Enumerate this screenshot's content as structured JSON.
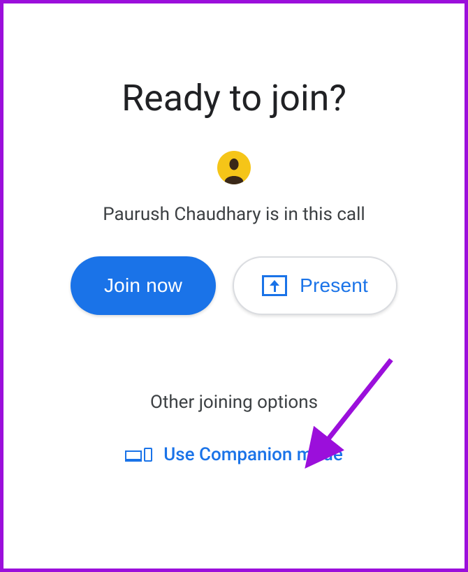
{
  "title": "Ready to join?",
  "participant_name": "Paurush Chaudhary",
  "call_status_suffix": " is in this call",
  "buttons": {
    "join_label": "Join now",
    "present_label": "Present"
  },
  "other_options": {
    "heading": "Other joining options",
    "companion_label": "Use Companion mode"
  },
  "colors": {
    "primary_blue": "#1a73e8",
    "text_dark": "#202124",
    "text_medium": "#3c4043",
    "border_gray": "#dadce0",
    "annotation_purple": "#9b0fdb",
    "avatar_bg": "#f5c518"
  }
}
